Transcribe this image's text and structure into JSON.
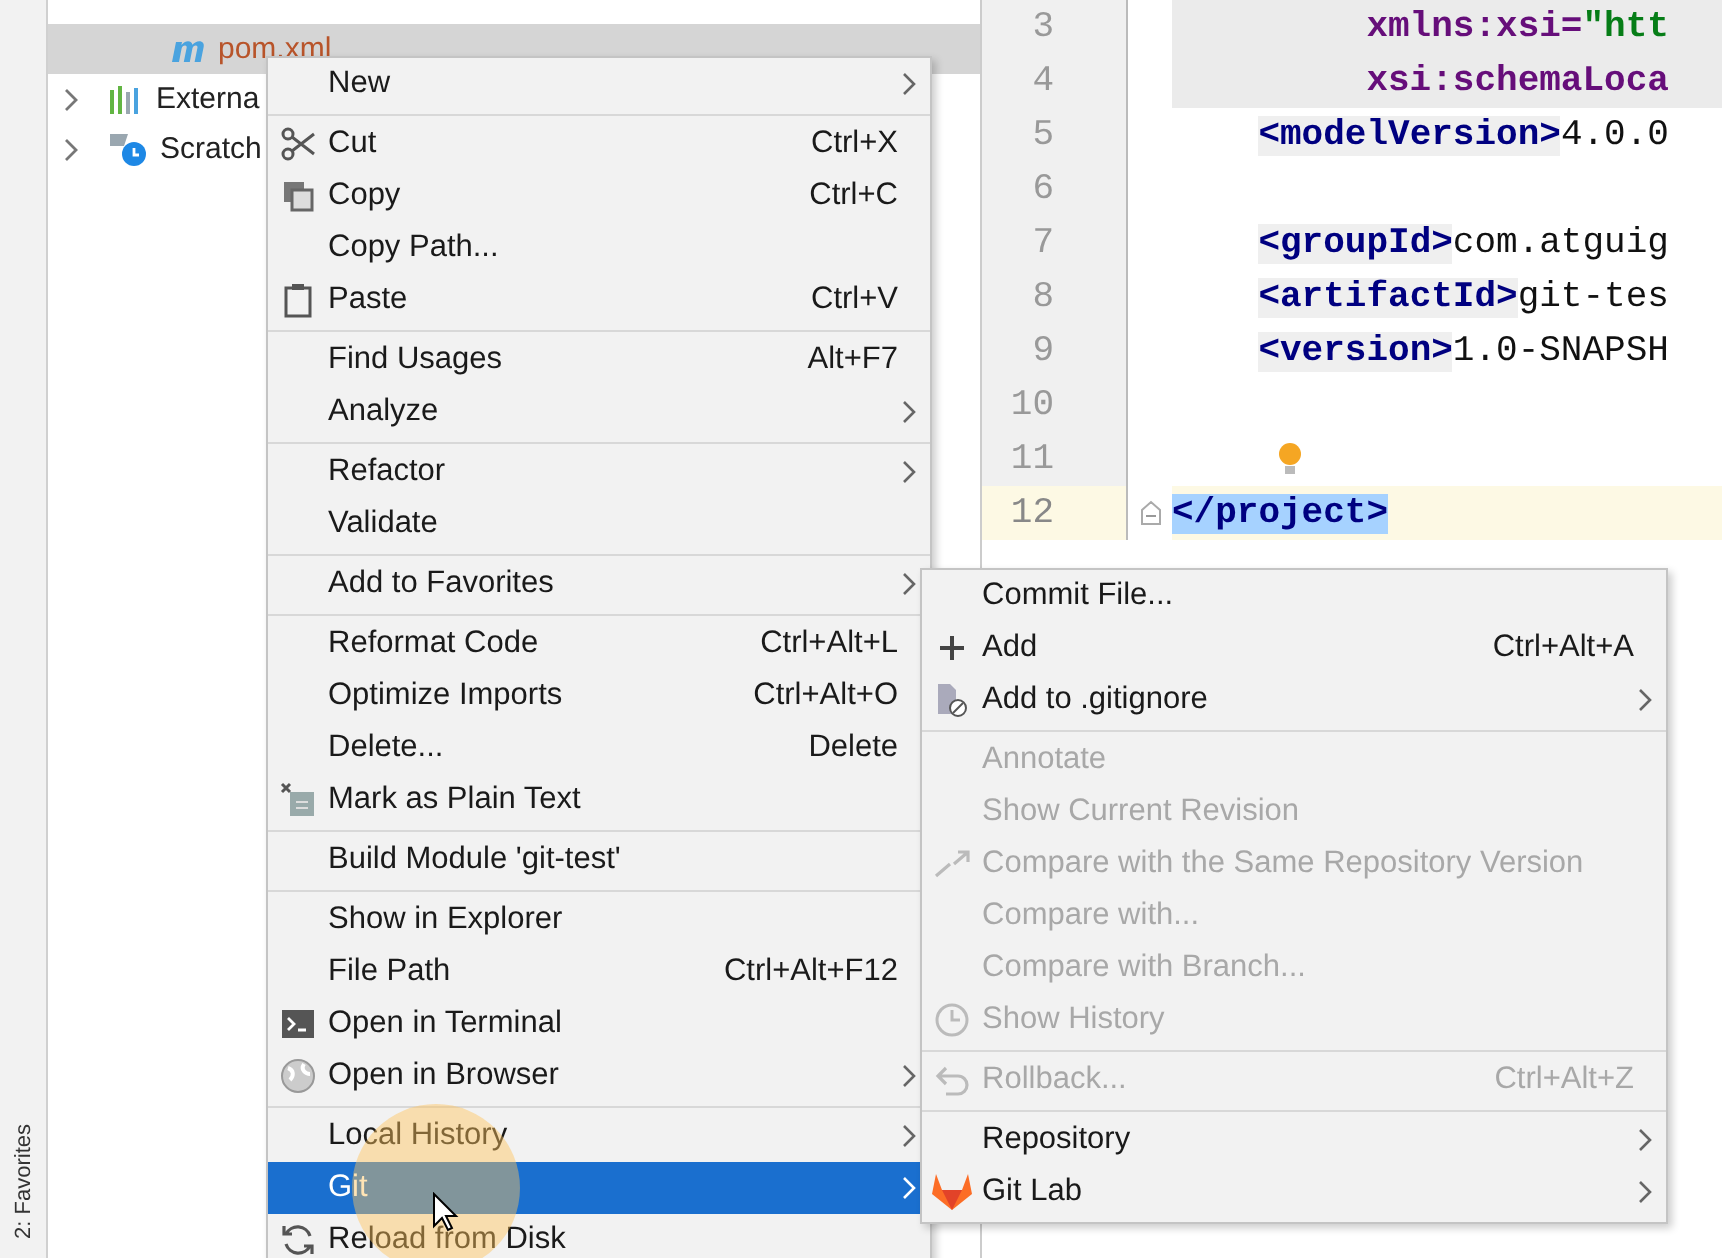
{
  "left_strip": {
    "tab": "2: Favorites"
  },
  "project_tree": [
    {
      "label": "pom.xml",
      "kind": "file",
      "selected": true,
      "expandable": false
    },
    {
      "label": "Externa",
      "kind": "library",
      "selected": false,
      "expandable": true
    },
    {
      "label": "Scratch",
      "kind": "scratch",
      "selected": false,
      "expandable": true
    }
  ],
  "editor": {
    "lines": [
      {
        "number": "3",
        "kind": "cont",
        "band": true,
        "current": false,
        "bulb": false,
        "fold": false,
        "segments": [
          {
            "text": "xmlns:xsi=",
            "kind": "attr",
            "selected": false
          },
          {
            "text": "\"htt",
            "kind": "string",
            "selected": false
          }
        ]
      },
      {
        "number": "4",
        "kind": "cont",
        "band": true,
        "current": false,
        "bulb": false,
        "fold": false,
        "segments": [
          {
            "text": "xsi:schemaLoca",
            "kind": "attr",
            "selected": false
          }
        ]
      },
      {
        "number": "5",
        "kind": "child",
        "band": false,
        "current": false,
        "bulb": false,
        "fold": false,
        "segments": [
          {
            "text": "<modelVersion>",
            "kind": "tag",
            "selected": false
          },
          {
            "text": "4.0.0",
            "kind": "text",
            "selected": false
          }
        ]
      },
      {
        "number": "6",
        "kind": "child",
        "band": false,
        "current": false,
        "bulb": false,
        "fold": false
      },
      {
        "number": "7",
        "kind": "child",
        "band": false,
        "current": false,
        "bulb": false,
        "fold": false,
        "segments": [
          {
            "text": "<groupId>",
            "kind": "tag",
            "selected": false
          },
          {
            "text": "com.atguig",
            "kind": "text",
            "selected": false
          }
        ]
      },
      {
        "number": "8",
        "kind": "child",
        "band": false,
        "current": false,
        "bulb": false,
        "fold": false,
        "segments": [
          {
            "text": "<artifactId>",
            "kind": "tag",
            "selected": false
          },
          {
            "text": "git-tes",
            "kind": "text",
            "selected": false
          }
        ]
      },
      {
        "number": "9",
        "kind": "child",
        "band": false,
        "current": false,
        "bulb": false,
        "fold": false,
        "segments": [
          {
            "text": "<version>",
            "kind": "tag",
            "selected": false
          },
          {
            "text": "1.0-SNAPSH",
            "kind": "text",
            "selected": false
          }
        ]
      },
      {
        "number": "10",
        "kind": "child",
        "band": false,
        "current": false,
        "bulb": false,
        "fold": false
      },
      {
        "number": "11",
        "kind": "child",
        "band": false,
        "current": false,
        "bulb": true,
        "fold": false
      },
      {
        "number": "12",
        "kind": "root",
        "band": false,
        "current": true,
        "bulb": false,
        "fold": true,
        "segments": [
          {
            "text": "</project>",
            "kind": "tag",
            "selected": true
          }
        ]
      }
    ]
  },
  "context_menu": {
    "groups": [
      {
        "items": [
          {
            "label": "New",
            "submenu": true,
            "selected": false,
            "disabled": false
          }
        ]
      },
      {
        "items": [
          {
            "label": "Cut",
            "shortcut": "Ctrl+X",
            "submenu": false,
            "selected": false,
            "disabled": false
          },
          {
            "label": "Copy",
            "shortcut": "Ctrl+C",
            "submenu": false,
            "selected": false,
            "disabled": false
          },
          {
            "label": "Copy Path...",
            "submenu": false,
            "selected": false,
            "disabled": false
          },
          {
            "label": "Paste",
            "shortcut": "Ctrl+V",
            "submenu": false,
            "selected": false,
            "disabled": false
          }
        ]
      },
      {
        "items": [
          {
            "label": "Find Usages",
            "shortcut": "Alt+F7",
            "submenu": false,
            "selected": false,
            "disabled": false
          },
          {
            "label": "Analyze",
            "submenu": true,
            "selected": false,
            "disabled": false
          }
        ]
      },
      {
        "items": [
          {
            "label": "Refactor",
            "submenu": true,
            "selected": false,
            "disabled": false
          },
          {
            "label": "Validate",
            "submenu": false,
            "selected": false,
            "disabled": false
          }
        ]
      },
      {
        "items": [
          {
            "label": "Add to Favorites",
            "submenu": true,
            "selected": false,
            "disabled": false
          }
        ]
      },
      {
        "items": [
          {
            "label": "Reformat Code",
            "shortcut": "Ctrl+Alt+L",
            "submenu": false,
            "selected": false,
            "disabled": false
          },
          {
            "label": "Optimize Imports",
            "shortcut": "Ctrl+Alt+O",
            "submenu": false,
            "selected": false,
            "disabled": false
          },
          {
            "label": "Delete...",
            "shortcut": "Delete",
            "submenu": false,
            "selected": false,
            "disabled": false
          },
          {
            "label": "Mark as Plain Text",
            "submenu": false,
            "selected": false,
            "disabled": false
          }
        ]
      },
      {
        "items": [
          {
            "label": "Build Module 'git-test'",
            "submenu": false,
            "selected": false,
            "disabled": false
          }
        ]
      },
      {
        "items": [
          {
            "label": "Show in Explorer",
            "submenu": false,
            "selected": false,
            "disabled": false
          },
          {
            "label": "File Path",
            "shortcut": "Ctrl+Alt+F12",
            "submenu": false,
            "selected": false,
            "disabled": false
          },
          {
            "label": "Open in Terminal",
            "submenu": false,
            "selected": false,
            "disabled": false
          },
          {
            "label": "Open in Browser",
            "submenu": true,
            "selected": false,
            "disabled": false
          }
        ]
      },
      {
        "items": [
          {
            "label": "Local History",
            "submenu": true,
            "selected": false,
            "disabled": false
          },
          {
            "label": "Git",
            "submenu": true,
            "selected": true,
            "disabled": false
          },
          {
            "label": "Reload from Disk",
            "submenu": false,
            "selected": false,
            "disabled": false
          }
        ]
      }
    ]
  },
  "git_submenu": {
    "groups": [
      {
        "items": [
          {
            "label": "Commit File...",
            "submenu": false,
            "selected": false,
            "disabled": false
          },
          {
            "label": "Add",
            "shortcut": "Ctrl+Alt+A",
            "submenu": false,
            "selected": false,
            "disabled": false
          },
          {
            "label": "Add to .gitignore",
            "submenu": true,
            "selected": false,
            "disabled": false
          }
        ]
      },
      {
        "items": [
          {
            "label": "Annotate",
            "submenu": false,
            "selected": false,
            "disabled": true
          },
          {
            "label": "Show Current Revision",
            "submenu": false,
            "selected": false,
            "disabled": true
          },
          {
            "label": "Compare with the Same Repository Version",
            "submenu": false,
            "selected": false,
            "disabled": true
          },
          {
            "label": "Compare with...",
            "submenu": false,
            "selected": false,
            "disabled": true
          },
          {
            "label": "Compare with Branch...",
            "submenu": false,
            "selected": false,
            "disabled": true
          },
          {
            "label": "Show History",
            "submenu": false,
            "selected": false,
            "disabled": true
          }
        ]
      },
      {
        "items": [
          {
            "label": "Rollback...",
            "shortcut": "Ctrl+Alt+Z",
            "submenu": false,
            "selected": false,
            "disabled": true
          }
        ]
      },
      {
        "items": [
          {
            "label": "Repository",
            "submenu": true,
            "selected": false,
            "disabled": false
          },
          {
            "label": "Git Lab",
            "submenu": true,
            "selected": false,
            "disabled": false
          }
        ]
      }
    ]
  }
}
